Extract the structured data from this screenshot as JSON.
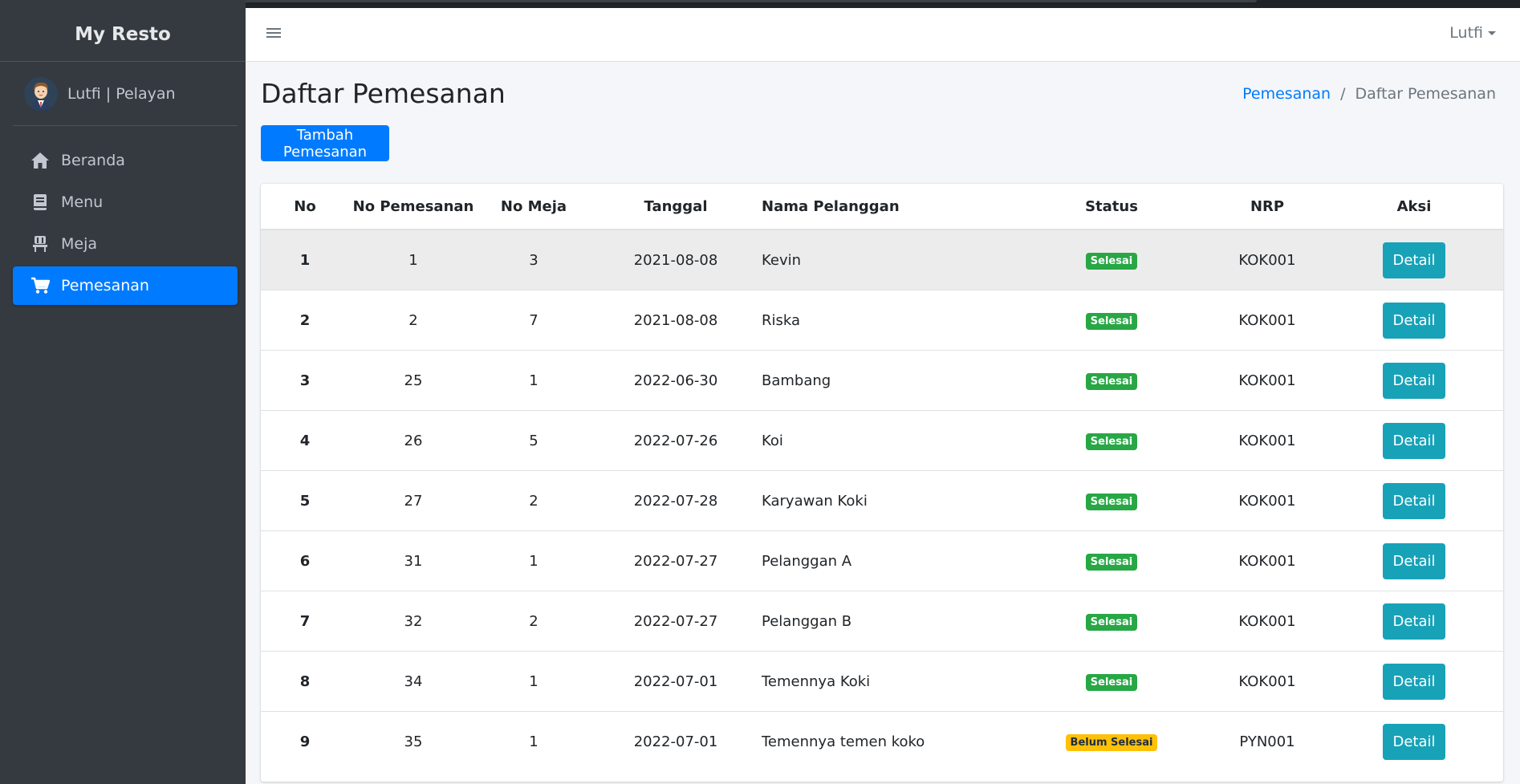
{
  "app": {
    "brand": "My Resto"
  },
  "sidebar": {
    "user": "Lutfi | Pelayan",
    "items": [
      {
        "label": "Beranda",
        "icon": "home-icon",
        "active": false
      },
      {
        "label": "Menu",
        "icon": "book-icon",
        "active": false
      },
      {
        "label": "Meja",
        "icon": "chair-icon",
        "active": false
      },
      {
        "label": "Pemesanan",
        "icon": "cart-icon",
        "active": true
      }
    ]
  },
  "header": {
    "user_menu": "Lutfi"
  },
  "page": {
    "title": "Daftar Pemesanan",
    "breadcrumb": [
      "Pemesanan",
      "Daftar Pemesanan"
    ],
    "add_button": "Tambah Pemesanan"
  },
  "table": {
    "headers": [
      "No",
      "No Pemesanan",
      "No Meja",
      "Tanggal",
      "Nama Pelanggan",
      "Status",
      "NRP",
      "Aksi"
    ],
    "detail_label": "Detail",
    "rows": [
      {
        "no": "1",
        "no_pemesanan": "1",
        "no_meja": "3",
        "tanggal": "2021-08-08",
        "nama": "Kevin",
        "status": "Selesai",
        "status_color": "#28a745",
        "nrp": "KOK001"
      },
      {
        "no": "2",
        "no_pemesanan": "2",
        "no_meja": "7",
        "tanggal": "2021-08-08",
        "nama": "Riska",
        "status": "Selesai",
        "status_color": "#28a745",
        "nrp": "KOK001"
      },
      {
        "no": "3",
        "no_pemesanan": "25",
        "no_meja": "1",
        "tanggal": "2022-06-30",
        "nama": "Bambang",
        "status": "Selesai",
        "status_color": "#28a745",
        "nrp": "KOK001"
      },
      {
        "no": "4",
        "no_pemesanan": "26",
        "no_meja": "5",
        "tanggal": "2022-07-26",
        "nama": "Koi",
        "status": "Selesai",
        "status_color": "#28a745",
        "nrp": "KOK001"
      },
      {
        "no": "5",
        "no_pemesanan": "27",
        "no_meja": "2",
        "tanggal": "2022-07-28",
        "nama": "Karyawan Koki",
        "status": "Selesai",
        "status_color": "#28a745",
        "nrp": "KOK001"
      },
      {
        "no": "6",
        "no_pemesanan": "31",
        "no_meja": "1",
        "tanggal": "2022-07-27",
        "nama": "Pelanggan A",
        "status": "Selesai",
        "status_color": "#28a745",
        "nrp": "KOK001"
      },
      {
        "no": "7",
        "no_pemesanan": "32",
        "no_meja": "2",
        "tanggal": "2022-07-27",
        "nama": "Pelanggan B",
        "status": "Selesai",
        "status_color": "#28a745",
        "nrp": "KOK001"
      },
      {
        "no": "8",
        "no_pemesanan": "34",
        "no_meja": "1",
        "tanggal": "2022-07-01",
        "nama": "Temennya Koki",
        "status": "Selesai",
        "status_color": "#28a745",
        "nrp": "KOK001"
      },
      {
        "no": "9",
        "no_pemesanan": "35",
        "no_meja": "1",
        "tanggal": "2022-07-01",
        "nama": "Temennya temen koko",
        "status": "Belum Selesai",
        "status_color": "#ffc107",
        "nrp": "PYN001"
      }
    ]
  },
  "colors": {
    "primary": "#007bff",
    "info": "#17a2b8",
    "sidebar": "#343a40"
  }
}
